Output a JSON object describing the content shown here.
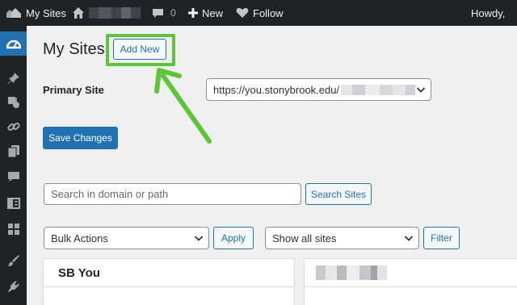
{
  "admin_bar": {
    "my_sites_label": "My Sites",
    "comments_count": "0",
    "new_label": "New",
    "follow_label": "Follow",
    "howdy_label": "Howdy,"
  },
  "sidebar": {
    "icons": [
      "dashboard-icon",
      "pin-icon",
      "media-icon",
      "link-icon",
      "pages-icon",
      "comments-icon",
      "feedback-icon",
      "blocks-icon",
      "brush-icon",
      "plugins-icon"
    ]
  },
  "page": {
    "title": "My Sites",
    "add_new_label": "Add New",
    "primary_site_label": "Primary Site",
    "primary_site_value": "https://you.stonybrook.edu/",
    "save_changes_label": "Save Changes",
    "search_placeholder": "Search in domain or path",
    "search_button_label": "Search Sites",
    "bulk_actions_value": "Bulk Actions",
    "apply_label": "Apply",
    "filter_value": "Show all sites",
    "filter_button_label": "Filter",
    "site_cards": [
      {
        "title": "SB You"
      }
    ]
  },
  "colors": {
    "admin_bar": "#1d2327",
    "accent": "#2271b1",
    "highlight": "#5fc43c",
    "background": "#f0f0f1"
  }
}
